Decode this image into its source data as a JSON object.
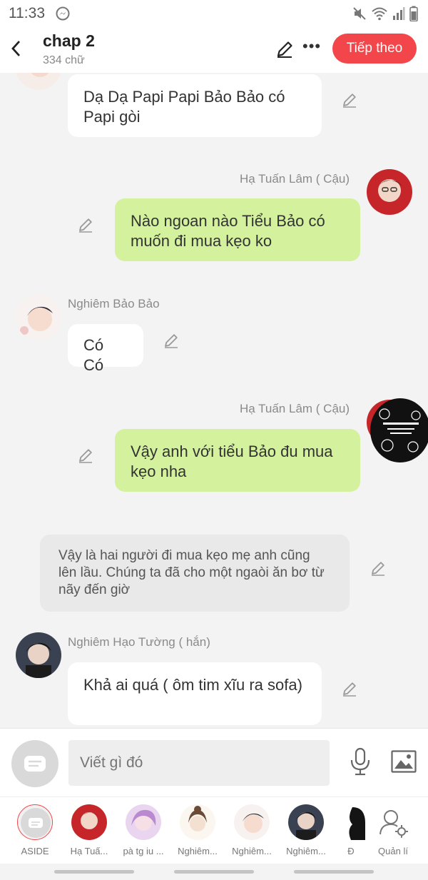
{
  "status_bar": {
    "time": "11:33"
  },
  "header": {
    "title": "chap 2",
    "subtitle": "334 chữ",
    "next_label": "Tiếp theo"
  },
  "messages": [
    {
      "type": "left",
      "speaker": "",
      "text": "Dạ Dạ Papi Papi Bảo Bảo có Papi gòi"
    },
    {
      "type": "right",
      "speaker": "Hạ Tuấn Lâm ( Cậu)",
      "text": "Nào ngoan nào Tiểu Bảo có muốn đi mua kẹo ko"
    },
    {
      "type": "left",
      "speaker": "Nghiêm Bảo Bảo",
      "text": "Có Có"
    },
    {
      "type": "right",
      "speaker": "Hạ Tuấn Lâm ( Cậu)",
      "text": "Vậy anh với tiểu Bảo đu mua kẹo nha"
    },
    {
      "type": "narration",
      "speaker": "",
      "text": "Vậy là hai người đi mua kẹo mẹ anh cũng lên lầu. Chúng ta đã cho một ngaòi ăn bơ từ nãy đến giờ"
    },
    {
      "type": "left",
      "speaker": "Nghiêm Hạo Tường ( hắn)",
      "text": "Khả ai quá ( ôm tim xĩu ra sofa)"
    }
  ],
  "input": {
    "placeholder": "Viết gì đó"
  },
  "characters": [
    {
      "label": "ASIDE"
    },
    {
      "label": "Hạ Tuấ..."
    },
    {
      "label": "pà tg iu ..."
    },
    {
      "label": "Nghiêm..."
    },
    {
      "label": "Nghiêm..."
    },
    {
      "label": "Nghiêm..."
    },
    {
      "label": "Đ"
    },
    {
      "label": "Quản lí"
    }
  ],
  "colors": {
    "accent": "#f2464a",
    "right_bubble": "#d4f29e",
    "left_bubble": "#ffffff",
    "narration_bubble": "#e9e9e9"
  }
}
